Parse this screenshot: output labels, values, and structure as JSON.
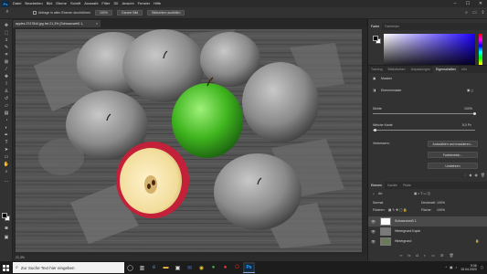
{
  "menubar": {
    "app_icon": "Ps",
    "items": [
      "Datei",
      "Bearbeiten",
      "Bild",
      "Ebene",
      "Schrift",
      "Auswahl",
      "Filter",
      "3D",
      "Ansicht",
      "Fenster",
      "Hilfe"
    ],
    "window_controls": [
      "minimize-icon",
      "maximize-icon",
      "close-icon"
    ]
  },
  "options_bar": {
    "checkbox_label": "Abfrage in allen Ebenen durchführen",
    "zoom_value": "100%",
    "fit_screen": "Ganzer Bild",
    "fill_screen": "Bildschirm ausfüllen"
  },
  "document_tab": {
    "title": "apples-3747844.jpg bei 21,3% (Schwarzweiß 1, Ebenenmaske/8) *",
    "close": "×"
  },
  "status_bar": {
    "zoom": "21,3%"
  },
  "color_panel": {
    "tabs": [
      "Farbe",
      "Farbfelder"
    ]
  },
  "properties_panel": {
    "tabs": [
      "Training",
      "Bibliotheken",
      "Anpassungen",
      "Eigenschaften",
      "Info"
    ],
    "mask_label": "Masken",
    "layer_mask_label": "Ebenenmaske",
    "density_label": "Dichte",
    "density_value": "100%",
    "feather_label": "Weiche Kante",
    "feather_value": "5,0 Px",
    "refine_label": "Verbessern:",
    "btn_select_mask": "Auswählen und maskieren...",
    "btn_color_range": "Farbbereich...",
    "btn_invert": "Umkehren"
  },
  "layers_panel": {
    "tabs": [
      "Ebenen",
      "Kanäle",
      "Pfade"
    ],
    "filter_label": "Art",
    "blend_mode": "Normal",
    "opacity_label": "Deckkraft:",
    "opacity_value": "100%",
    "lock_label": "Fixieren:",
    "fill_label": "Fläche:",
    "fill_value": "100%",
    "layers": [
      {
        "name": "Schwarzweiß 1",
        "active": true
      },
      {
        "name": "Hintergrund Kopie",
        "active": false
      },
      {
        "name": "Hintergrund",
        "active": false
      }
    ]
  },
  "taskbar": {
    "search_placeholder": "Zur Suche Text hier eingeben",
    "time": "9:36",
    "date": "15.04.2020",
    "ps_label": "Ps"
  }
}
